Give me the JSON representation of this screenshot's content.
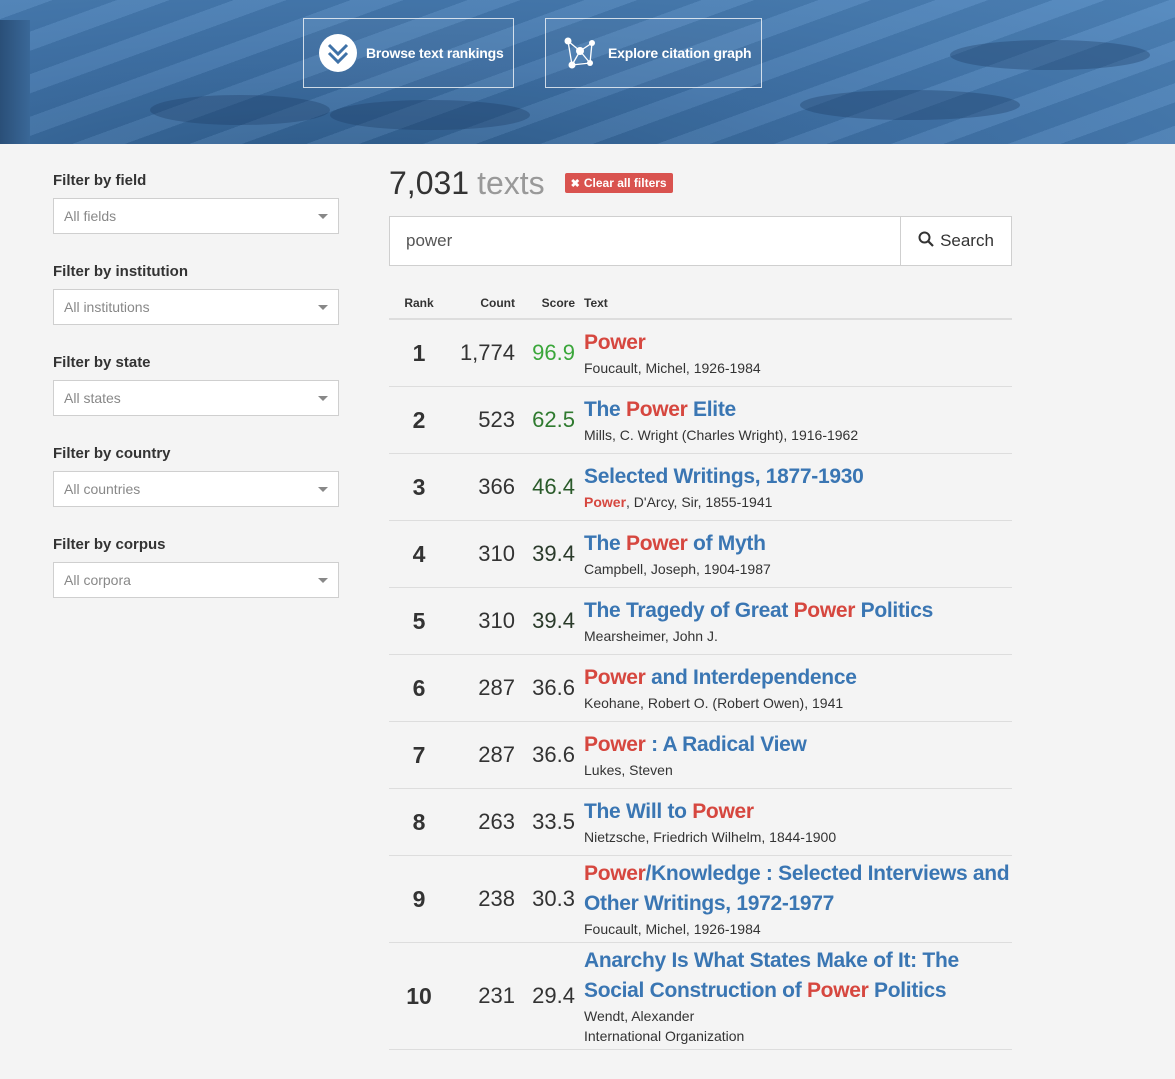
{
  "header": {
    "browse_label": "Browse text rankings",
    "explore_label": "Explore citation graph"
  },
  "filters": [
    {
      "label": "Filter by field",
      "value": "All fields"
    },
    {
      "label": "Filter by institution",
      "value": "All institutions"
    },
    {
      "label": "Filter by state",
      "value": "All states"
    },
    {
      "label": "Filter by country",
      "value": "All countries"
    },
    {
      "label": "Filter by corpus",
      "value": "All corpora"
    }
  ],
  "results": {
    "count": "7,031",
    "unit": "texts",
    "clear_label": "Clear all filters"
  },
  "search": {
    "value": "power",
    "button_label": "Search"
  },
  "table": {
    "headers": {
      "rank": "Rank",
      "count": "Count",
      "score": "Score",
      "text": "Text"
    },
    "rows": [
      {
        "rank": "1",
        "count": "1,774",
        "score": "96.9",
        "score_color": "#3aa63a",
        "title_parts": [
          {
            "t": "Power",
            "hl": true
          }
        ],
        "author_parts": [
          {
            "t": "Foucault, Michel, 1926-1984",
            "hl": false
          }
        ]
      },
      {
        "rank": "2",
        "count": "523",
        "score": "62.5",
        "score_color": "#2f7a2f",
        "title_parts": [
          {
            "t": "The ",
            "hl": false
          },
          {
            "t": "Power",
            "hl": true
          },
          {
            "t": " Elite",
            "hl": false
          }
        ],
        "author_parts": [
          {
            "t": "Mills, C. Wright (Charles Wright), 1916-1962",
            "hl": false
          }
        ]
      },
      {
        "rank": "3",
        "count": "366",
        "score": "46.4",
        "score_color": "#2a5a2a",
        "title_parts": [
          {
            "t": "Selected Writings, 1877-1930",
            "hl": false
          }
        ],
        "author_parts": [
          {
            "t": "Power",
            "hl": true
          },
          {
            "t": ", D'Arcy, Sir, 1855-1941",
            "hl": false
          }
        ]
      },
      {
        "rank": "4",
        "count": "310",
        "score": "39.4",
        "score_color": "#2a3a2a",
        "title_parts": [
          {
            "t": "The ",
            "hl": false
          },
          {
            "t": "Power",
            "hl": true
          },
          {
            "t": " of Myth",
            "hl": false
          }
        ],
        "author_parts": [
          {
            "t": "Campbell, Joseph, 1904-1987",
            "hl": false
          }
        ]
      },
      {
        "rank": "5",
        "count": "310",
        "score": "39.4",
        "score_color": "#2a3a2a",
        "title_parts": [
          {
            "t": "The Tragedy of Great ",
            "hl": false
          },
          {
            "t": "Power",
            "hl": true
          },
          {
            "t": " Politics",
            "hl": false
          }
        ],
        "author_parts": [
          {
            "t": "Mearsheimer, John J.",
            "hl": false
          }
        ]
      },
      {
        "rank": "6",
        "count": "287",
        "score": "36.6",
        "score_color": "#333333",
        "title_parts": [
          {
            "t": "Power",
            "hl": true
          },
          {
            "t": " and Interdependence",
            "hl": false
          }
        ],
        "author_parts": [
          {
            "t": "Keohane, Robert O. (Robert Owen), 1941",
            "hl": false
          }
        ]
      },
      {
        "rank": "7",
        "count": "287",
        "score": "36.6",
        "score_color": "#333333",
        "title_parts": [
          {
            "t": "Power",
            "hl": true
          },
          {
            "t": " : A Radical View",
            "hl": false
          }
        ],
        "author_parts": [
          {
            "t": "Lukes, Steven",
            "hl": false
          }
        ]
      },
      {
        "rank": "8",
        "count": "263",
        "score": "33.5",
        "score_color": "#333333",
        "title_parts": [
          {
            "t": "The Will to ",
            "hl": false
          },
          {
            "t": "Power",
            "hl": true
          }
        ],
        "author_parts": [
          {
            "t": "Nietzsche, Friedrich Wilhelm, 1844-1900",
            "hl": false
          }
        ]
      },
      {
        "rank": "9",
        "count": "238",
        "score": "30.3",
        "score_color": "#333333",
        "title_parts": [
          {
            "t": "Power",
            "hl": true
          },
          {
            "t": "/Knowledge : Selected Interviews and Other Writings, 1972-1977",
            "hl": false
          }
        ],
        "author_parts": [
          {
            "t": "Foucault, Michel, 1926-1984",
            "hl": false
          }
        ]
      },
      {
        "rank": "10",
        "count": "231",
        "score": "29.4",
        "score_color": "#333333",
        "title_parts": [
          {
            "t": "Anarchy Is What States Make of It: The Social Construction of ",
            "hl": false
          },
          {
            "t": "Power",
            "hl": true
          },
          {
            "t": " Politics",
            "hl": false
          }
        ],
        "author_parts": [
          {
            "t": "Wendt, Alexander",
            "hl": false
          }
        ],
        "extra": "International Organization"
      }
    ]
  }
}
